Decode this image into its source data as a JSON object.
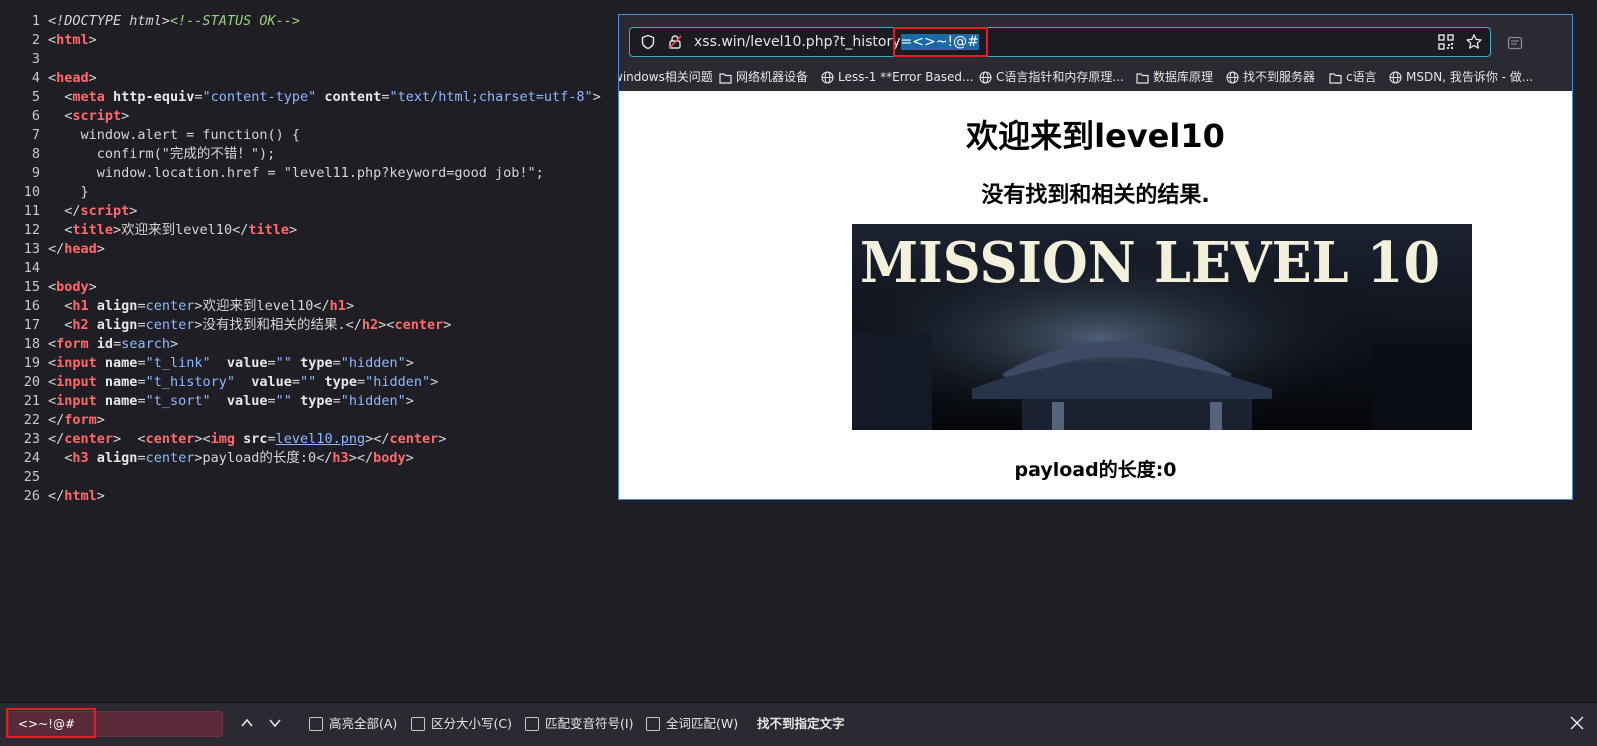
{
  "source_lines": [
    {
      "n": "1"
    },
    {
      "n": "2"
    },
    {
      "n": "3"
    },
    {
      "n": "4"
    },
    {
      "n": "5"
    },
    {
      "n": "6"
    },
    {
      "n": "7"
    },
    {
      "n": "8"
    },
    {
      "n": "9"
    },
    {
      "n": "10"
    },
    {
      "n": "11"
    },
    {
      "n": "12"
    },
    {
      "n": "13"
    },
    {
      "n": "14"
    },
    {
      "n": "15"
    },
    {
      "n": "16"
    },
    {
      "n": "17"
    },
    {
      "n": "18"
    },
    {
      "n": "19"
    },
    {
      "n": "20"
    },
    {
      "n": "21"
    },
    {
      "n": "22"
    },
    {
      "n": "23"
    },
    {
      "n": "24"
    },
    {
      "n": "25"
    },
    {
      "n": "26"
    }
  ],
  "src": {
    "l1_doctype": "<!DOCTYPE html>",
    "l1_comment": "<!--STATUS OK-->",
    "l2": "html",
    "l4": "head",
    "l5_tag": "meta",
    "l5_attr1": "http-equiv",
    "l5_val1": "\"content-type\"",
    "l5_attr2": "content",
    "l5_val2": "\"text/html;charset=utf-8\"",
    "l6": "script",
    "l7": "window.alert = function() {",
    "l8": "confirm(\"完成的不错！\");",
    "l9": "window.location.href = \"level11.php?keyword=good job!\";",
    "l10": "}",
    "l11": "script",
    "l12_tag": "title",
    "l12_text": "欢迎来到level10",
    "l13": "head",
    "l15": "body",
    "l16_tag": "h1",
    "l16_attr": "align",
    "l16_val": "center",
    "l16_text": "欢迎来到level10",
    "l17_tag": "h2",
    "l17_text": "没有找到和相关的结果.",
    "l17_tag2": "center",
    "l18_tag": "form",
    "l18_attr": "id",
    "l18_val": "search",
    "l19_tag": "input",
    "l19_name": "\"t_link\"",
    "l20_name": "\"t_history\"",
    "l21_name": "\"t_sort\"",
    "attr_name": "name",
    "attr_value": "value",
    "attr_type": "type",
    "val_empty": "\"\"",
    "val_hidden": "\"hidden\"",
    "l22": "form",
    "l23_center": "center",
    "l23_img": "img",
    "l23_src": "src",
    "l23_link": "level10.png",
    "l24_tag": "h3",
    "l24_text": "payload的长度:0",
    "l24_body": "body",
    "l26": "html"
  },
  "browser": {
    "url_prefix": "xss.win/level10.php?t_histor",
    "url_mid": "y",
    "url_selected": "=<>~!@#",
    "bookmarks": [
      "windows相关问题",
      "网络机器设备",
      "Less-1 **Error Based...",
      "C语言指针和内存原理...",
      "数据库原理",
      "找不到服务器",
      "c语言",
      "MSDN, 我告诉你 - 做..."
    ],
    "page": {
      "h1": "欢迎来到level10",
      "h2": "没有找到和相关的结果.",
      "image_text": "MISSION LEVEL 10",
      "h3": "payload的长度:0"
    }
  },
  "findbar": {
    "input_value": "<>~!@#",
    "highlight_all": "高亮全部(A)",
    "match_case": "区分大小写(C)",
    "match_diacritics": "匹配变音符号(I)",
    "whole_words": "全词匹配(W)",
    "status": "找不到指定文字"
  }
}
